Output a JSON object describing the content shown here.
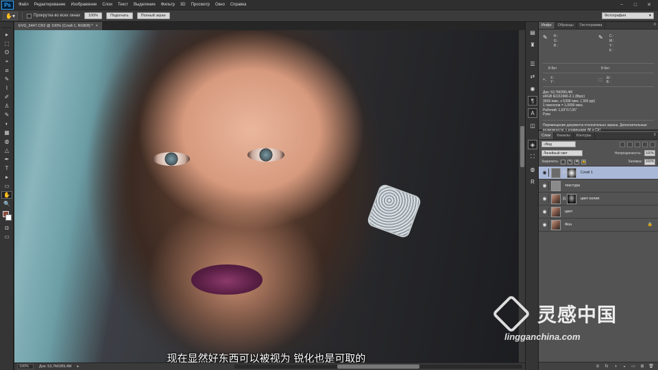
{
  "app": {
    "logo": "Ps",
    "menu": [
      "Файл",
      "Редактирование",
      "Изображение",
      "Слои",
      "Текст",
      "Выделение",
      "Фильтр",
      "3D",
      "Просмотр",
      "Окно",
      "Справка"
    ],
    "window_controls": [
      "−",
      "□",
      "✕"
    ]
  },
  "options": {
    "scroll_all_label": "Прокрутка во всех окнах",
    "zoom_value": "100%",
    "fit_label": "Подогнать",
    "fullscreen_label": "Полный экран",
    "workspace": "Фотография"
  },
  "document": {
    "tab_title": "EVG_5447.CR2 @ 100% (Слой 1, RGB/8) *",
    "tab_close": "×",
    "caption": "现在显然好东西可以被视为 锐化也是可取的",
    "status_zoom": "100%",
    "status_doc": "Док: 53,7М/289,4М"
  },
  "tools": [
    "▸",
    "⬚",
    "ʘ",
    "⌖",
    "⧄",
    "✎",
    "⌇",
    "✐",
    "♙",
    "✎",
    "◐",
    "▦",
    "◍",
    "△",
    "✒",
    "T",
    "▸",
    "▭",
    "✋",
    "🔍"
  ],
  "strip_icons": [
    "▤",
    "♜",
    "☰",
    "⇄",
    "◉",
    "¶",
    "A",
    "◫",
    "◈",
    "⛶",
    "◍",
    "R"
  ],
  "panels": {
    "top_tabs": [
      "Инфо",
      "Образцы",
      "Гистограмма"
    ],
    "info": {
      "left_big": "✎",
      "left_labels": [
        "R :",
        "G :",
        "B :"
      ],
      "right_big": "✎",
      "right_labels": [
        "C :",
        "M :",
        "Y :",
        "K :"
      ],
      "left_bits": "8-бит",
      "right_bits": "8-бит",
      "xy_left_icon": "+,",
      "xy_left": [
        "X :",
        "Y :"
      ],
      "xy_right_icon": "⬚",
      "xy_right": [
        "Ш :",
        "В :"
      ],
      "lines": [
        "Док: 53,7М/289,4М",
        "sRGB IEC61966-2.1 (8bpc)",
        "3939 пикс. x 5308 пикс. ( 300 ppi)",
        "1 пикселов = 1,0000 пикс.",
        "Рабочий: 1,03\"/17,05\"",
        "Рука"
      ],
      "hint": "Перемещение документа относительно экрана. Дополнительные возможности: с клавишами Alt и Ctrl"
    },
    "layer_tabs": [
      "Слои",
      "Каналы",
      "Контуры"
    ],
    "filter_kind": "Вид",
    "blend_mode": "Линейный свет",
    "opacity_label": "Непрозрачность:",
    "opacity_value": "100%",
    "lock_label": "Закрепить:",
    "fill_label": "Заливка:",
    "fill_value": "100%",
    "layers": [
      {
        "name": "Слой 1",
        "selected": true
      },
      {
        "name": "текстура",
        "selected": false
      },
      {
        "name": "цвет копия",
        "selected": false
      },
      {
        "name": "цвет",
        "selected": false
      },
      {
        "name": "Фон",
        "selected": false
      }
    ],
    "footer_icons": [
      "⊝",
      "fx",
      "◑",
      "◒",
      "▭",
      "⊞",
      "🗑"
    ]
  },
  "watermark": {
    "title": "灵感中国",
    "subtitle": "lingganchina.com"
  }
}
